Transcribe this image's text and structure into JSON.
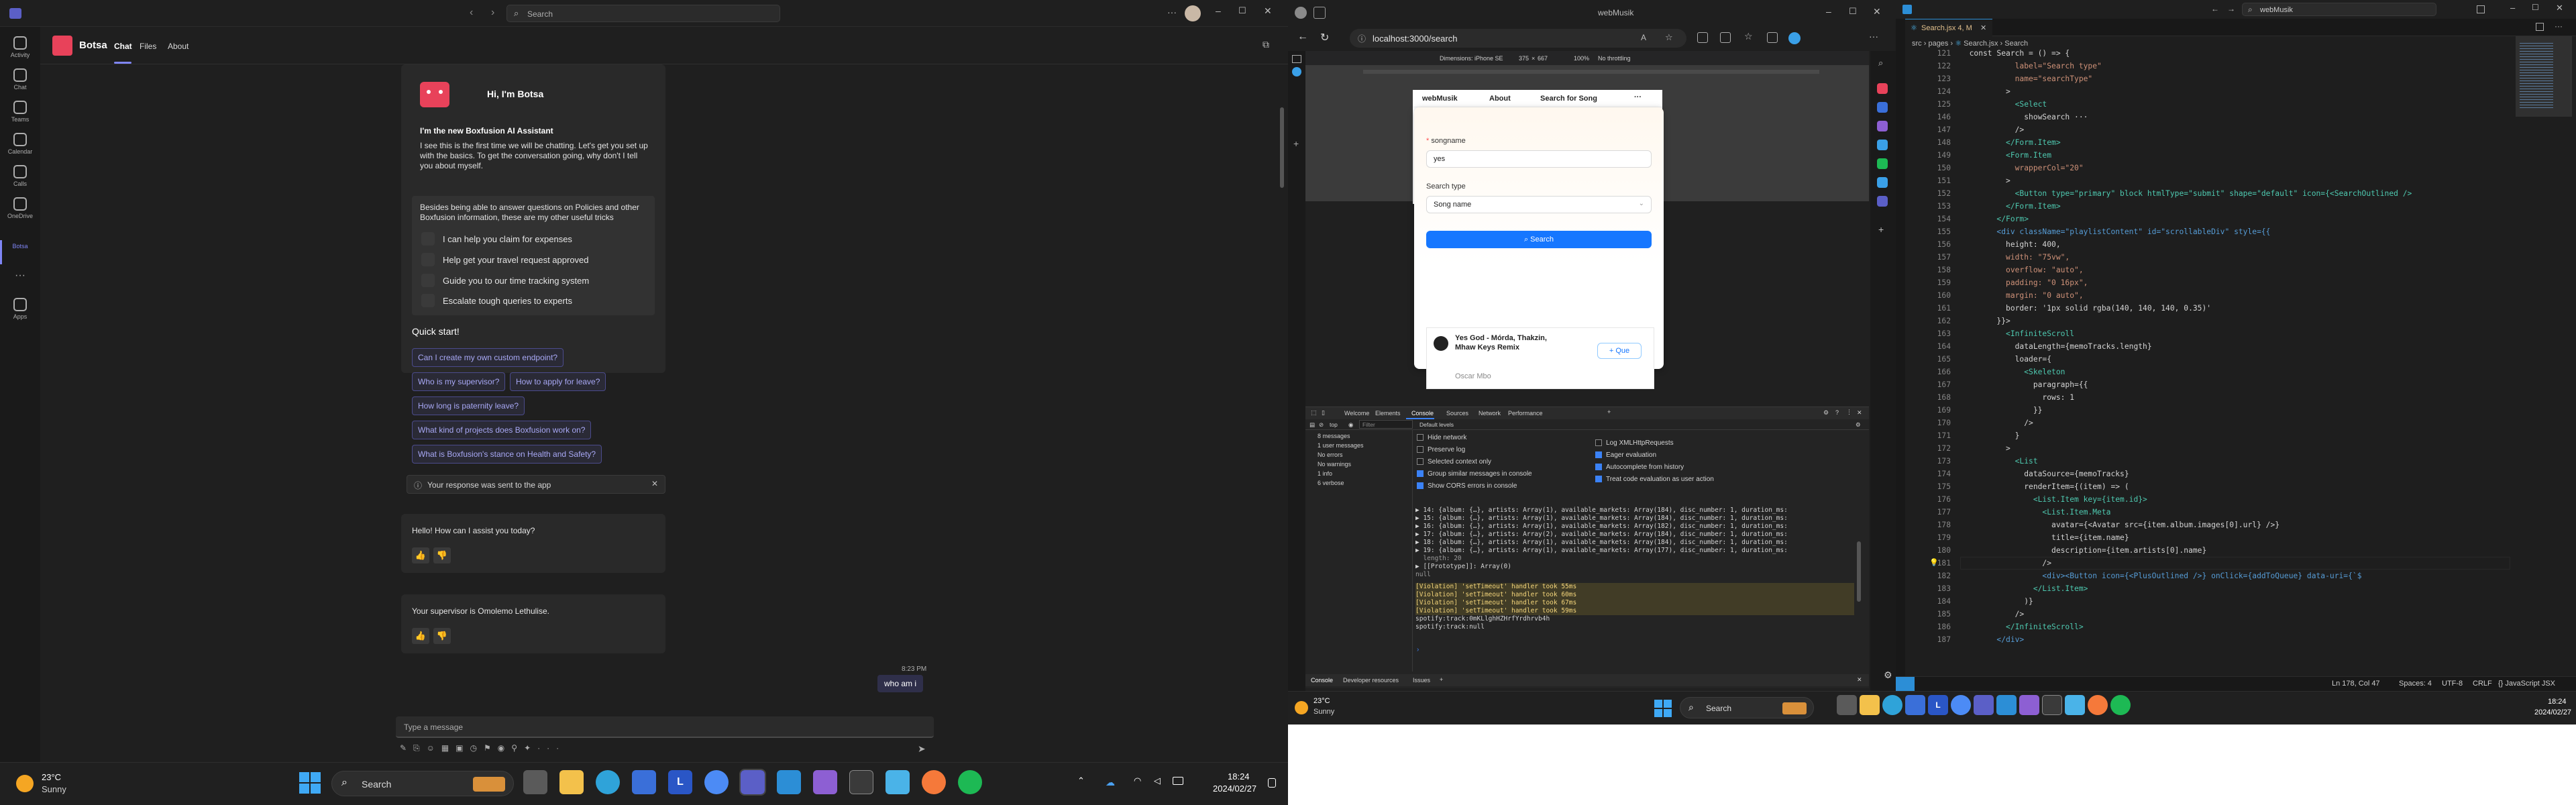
{
  "teams": {
    "search_placeholder": "Search",
    "app_name": "Botsa",
    "tabs": [
      "Chat",
      "Files",
      "About"
    ],
    "rail": [
      {
        "label": "Activity"
      },
      {
        "label": "Chat"
      },
      {
        "label": "Teams"
      },
      {
        "label": "Calendar"
      },
      {
        "label": "Calls"
      },
      {
        "label": "OneDrive"
      },
      {
        "label": "Botsa"
      },
      {
        "label": "Apps"
      }
    ],
    "greeting_title": "Hi, I'm Botsa",
    "intro_heading": "I'm the new Boxfusion AI Assistant",
    "intro_body": "I see this is the first time we will be chatting. Let's get you set up with the basics. To get the conversation going, why don't I tell you about myself.",
    "tricks_intro": "Besides being able to answer questions on Policies and other Boxfusion information, these are my other useful tricks",
    "features": [
      "I can help you claim for expenses",
      "Help get your travel request approved",
      "Guide you to our time tracking system",
      "Escalate tough queries to experts"
    ],
    "quick_start_title": "Quick start!",
    "quick_starts": [
      "Can I create my own custom endpoint?",
      "Who is my supervisor?",
      "How to apply for leave?",
      "How long is paternity leave?",
      "What kind of projects does Boxfusion work on?",
      "What is Boxfusion's stance on Health and Safety?"
    ],
    "sent_notice": "Your response was sent to the app",
    "bot_reply_1": "Hello! How can I assist you today?",
    "bot_reply_2": "Your supervisor is Omolemo Lethulise.",
    "user_time": "8:23 PM",
    "user_message": "who am i",
    "composer_placeholder": "Type a message"
  },
  "taskbar_left": {
    "temp": "23°C",
    "weather": "Sunny",
    "search": "Search",
    "time": "18:24",
    "date": "2024/02/27"
  },
  "edge": {
    "window_title": "webMusik",
    "url": "localhost:3000/search",
    "device_toolbar": {
      "dimensions": "Dimensions: iPhone SE",
      "width": "375",
      "height": "667",
      "zoom": "100%",
      "throttle": "No throttling"
    },
    "app": {
      "brand": "webMusik",
      "nav": [
        "About",
        "Search for Song"
      ],
      "more": "···",
      "songname_label": "songname",
      "songname_value": "yes",
      "search_type_label": "Search type",
      "search_type_value": "Song name",
      "search_button": "Search",
      "result_title": "Yes God - Mórda, Thakzin, Mhaw Keys Remix",
      "result_artist": "Oscar Mbo",
      "queue_button": "Que"
    },
    "devtools": {
      "tabs": [
        "Welcome",
        "Elements",
        "Console",
        "Sources",
        "Network",
        "Performance"
      ],
      "context": "top",
      "filter_placeholder": "Filter",
      "levels": "Default levels",
      "sidebar": [
        "8 messages",
        "1 user messages",
        "No errors",
        "No warnings",
        "1 info",
        "6 verbose"
      ],
      "settings_left": [
        "Hide network",
        "Preserve log",
        "Selected context only",
        "Group similar messages in console",
        "Show CORS errors in console"
      ],
      "settings_right": [
        "Log XMLHttpRequests",
        "Eager evaluation",
        "Autocomplete from history",
        "Treat code evaluation as user action"
      ],
      "log_lines": [
        "▶ 14: {album: {…}, artists: Array(1), available_markets: Array(184), disc_number: 1, duration_ms:",
        "▶ 15: {album: {…}, artists: Array(1), available_markets: Array(184), disc_number: 1, duration_ms:",
        "▶ 16: {album: {…}, artists: Array(1), available_markets: Array(182), disc_number: 1, duration_ms:",
        "▶ 17: {album: {…}, artists: Array(2), available_markets: Array(184), disc_number: 1, duration_ms:",
        "▶ 18: {album: {…}, artists: Array(1), available_markets: Array(184), disc_number: 1, duration_ms:",
        "▶ 19: {album: {…}, artists: Array(1), available_markets: Array(177), disc_number: 1, duration_ms:",
        "  length: 20",
        "▶ [[Prototype]]: Array(0)",
        "null"
      ],
      "violations": [
        "[Violation] 'setTimeout' handler took 55ms",
        "[Violation] 'setTimeout' handler took 60ms",
        "[Violation] 'setTimeout' handler took 67ms",
        "[Violation] 'setTimeout' handler took 59ms"
      ],
      "spotify_line_1": "spotify:track:0mKLlghHZHrfYrdhrvb4h",
      "spotify_line_2": "spotify:track:null",
      "bottom_tabs": [
        "Console",
        "Developer resources",
        "Issues"
      ]
    }
  },
  "vscode": {
    "title": "webMusik",
    "tab": "Search.jsx 4, M",
    "breadcrumb": [
      "src",
      "pages",
      "Search.jsx",
      "Search"
    ],
    "lines": [
      {
        "n": "",
        "t": "  const Search = () => {"
      },
      {
        "n": "121",
        "t": "            label=\"Search type\""
      },
      {
        "n": "122",
        "t": "            name=\"searchType\""
      },
      {
        "n": "123",
        "t": "          >"
      },
      {
        "n": "124",
        "t": "            <Select"
      },
      {
        "n": "125",
        "t": "              showSearch ···"
      },
      {
        "n": "146",
        "t": "            />"
      },
      {
        "n": "147",
        "t": "          </Form.Item>"
      },
      {
        "n": "148",
        "t": "          <Form.Item"
      },
      {
        "n": "149",
        "t": "            wrapperCol=\"20\""
      },
      {
        "n": "150",
        "t": "          >"
      },
      {
        "n": "151",
        "t": "            <Button type=\"primary\" block htmlType=\"submit\" shape=\"default\" icon={<SearchOutlined />"
      },
      {
        "n": "152",
        "t": "          </Form.Item>"
      },
      {
        "n": "153",
        "t": "        </Form>"
      },
      {
        "n": "154",
        "t": "        <div className=\"playlistContent\" id=\"scrollableDiv\" style={{"
      },
      {
        "n": "155",
        "t": "          height: 400,"
      },
      {
        "n": "156",
        "t": "          width: \"75vw\","
      },
      {
        "n": "157",
        "t": "          overflow: \"auto\","
      },
      {
        "n": "158",
        "t": "          padding: \"0 16px\","
      },
      {
        "n": "159",
        "t": "          margin: \"0 auto\","
      },
      {
        "n": "160",
        "t": "          border: '1px solid rgba(140, 140, 140, 0.35)'"
      },
      {
        "n": "161",
        "t": "        }}>"
      },
      {
        "n": "162",
        "t": "          <InfiniteScroll"
      },
      {
        "n": "163",
        "t": "            dataLength={memoTracks.length}"
      },
      {
        "n": "164",
        "t": "            loader={"
      },
      {
        "n": "165",
        "t": "              <Skeleton"
      },
      {
        "n": "166",
        "t": "                paragraph={{"
      },
      {
        "n": "167",
        "t": "                  rows: 1"
      },
      {
        "n": "168",
        "t": "                }}"
      },
      {
        "n": "169",
        "t": "              />"
      },
      {
        "n": "170",
        "t": "            }"
      },
      {
        "n": "171",
        "t": "          >"
      },
      {
        "n": "172",
        "t": "            <List"
      },
      {
        "n": "173",
        "t": "              dataSource={memoTracks}"
      },
      {
        "n": "174",
        "t": "              renderItem={(item) => ("
      },
      {
        "n": "175",
        "t": "                <List.Item key={item.id}>"
      },
      {
        "n": "176",
        "t": "                  <List.Item.Meta"
      },
      {
        "n": "177",
        "t": "                    avatar={<Avatar src={item.album.images[0].url} />}"
      },
      {
        "n": "178",
        "t": "                    title={item.name}"
      },
      {
        "n": "179",
        "t": "                    description={item.artists[0].name}"
      },
      {
        "n": "180",
        "t": "                  />"
      },
      {
        "n": "181",
        "t": "                  <div><Button icon={<PlusOutlined />} onClick={addToQueue} data-uri={`$"
      },
      {
        "n": "182",
        "t": "                </List.Item>"
      },
      {
        "n": "183",
        "t": "              )}"
      },
      {
        "n": "184",
        "t": "            />"
      },
      {
        "n": "185",
        "t": "          </InfiniteScroll>"
      },
      {
        "n": "186",
        "t": "        </div>"
      },
      {
        "n": "187",
        "t": ""
      }
    ],
    "status": {
      "position": "Ln 178, Col 47",
      "spaces": "Spaces: 4",
      "encoding": "UTF-8",
      "eol": "CRLF",
      "language": "JavaScript JSX"
    }
  },
  "taskbar_right": {
    "temp": "23°C",
    "weather": "Sunny",
    "search": "Search",
    "time": "18:24",
    "date": "2024/02/27"
  },
  "colors": {
    "teams_accent": "#7f85f5",
    "botsa_brand": "#e8425a",
    "antd_primary": "#1677ff",
    "vscode_bg": "#1e1e1e",
    "spotify": "#1db954"
  }
}
